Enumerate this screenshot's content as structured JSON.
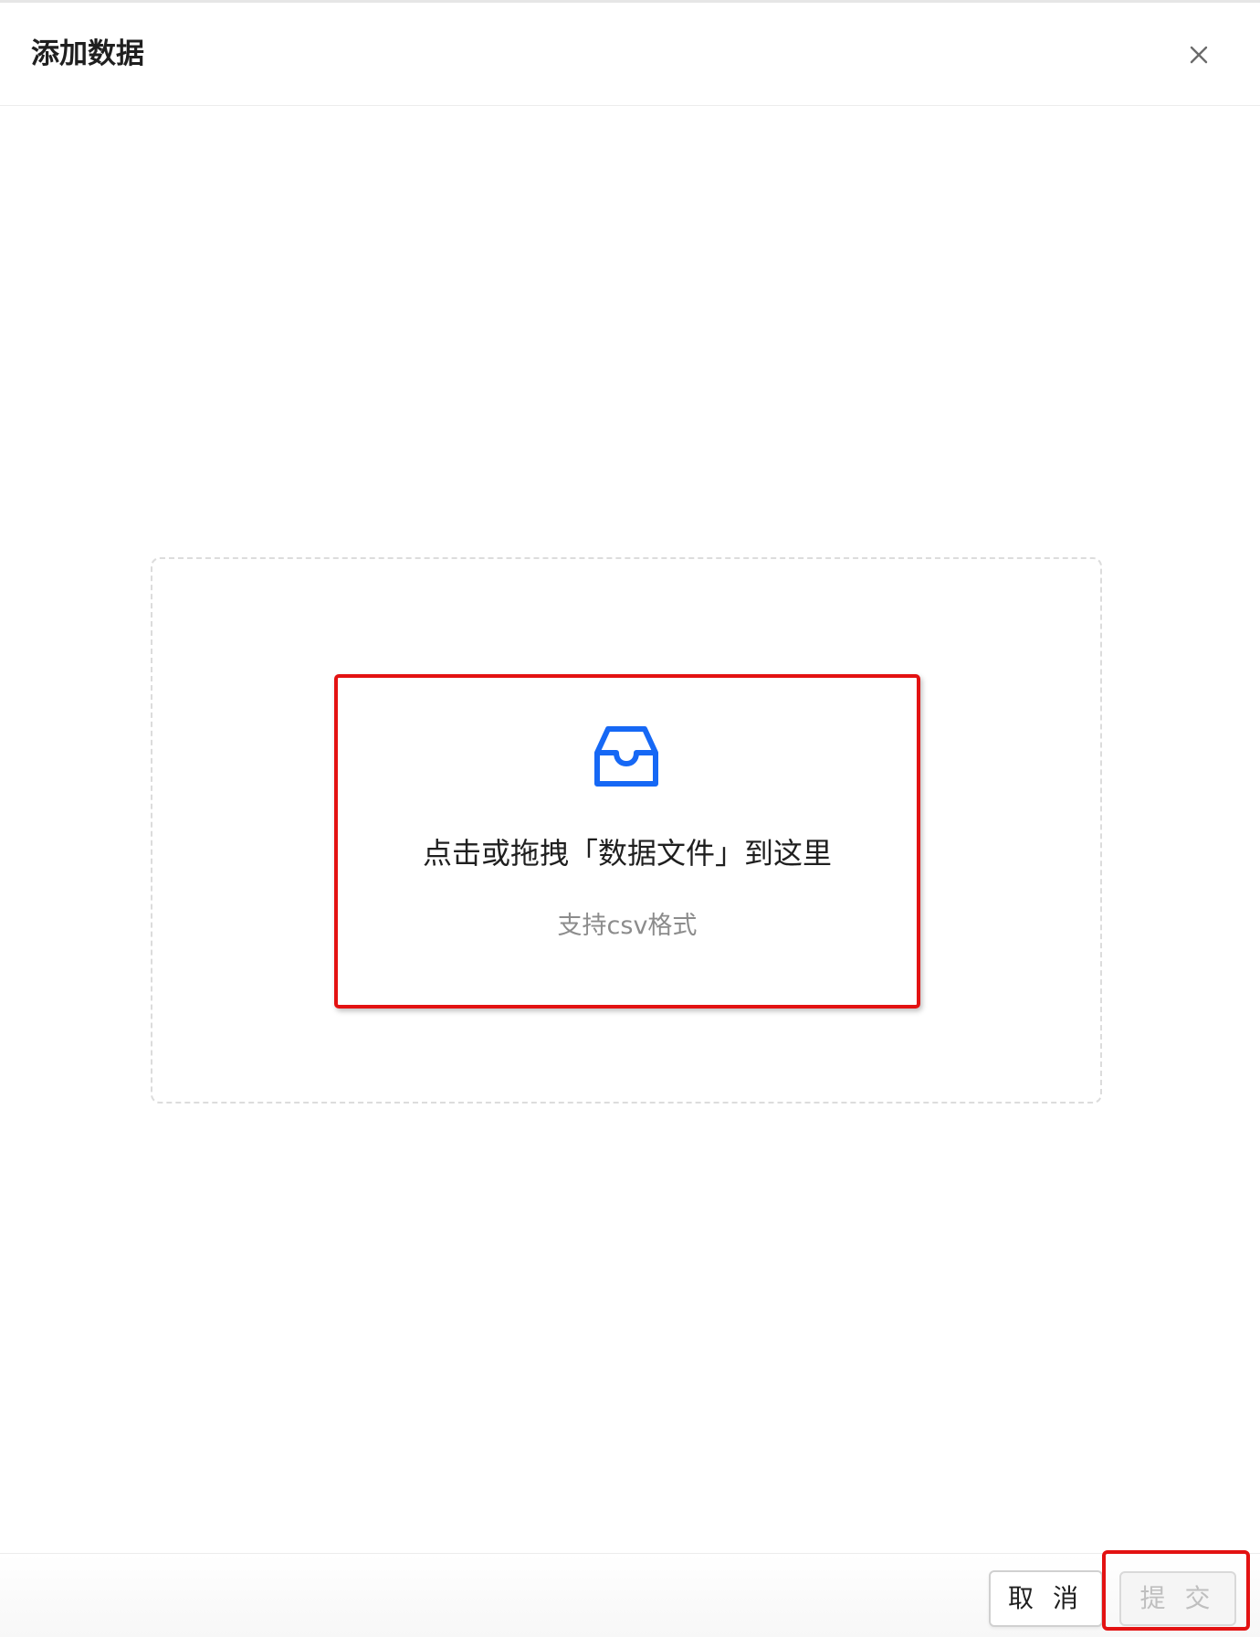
{
  "modal": {
    "title": "添加数据",
    "close_icon": "close-icon"
  },
  "upload": {
    "icon": "inbox-icon",
    "icon_color": "#1668f5",
    "text": "点击或拖拽「数据文件」到这里",
    "hint": "支持csv格式"
  },
  "footer": {
    "cancel_label": "取 消",
    "submit_label": "提 交",
    "submit_disabled": true
  },
  "highlight_color": "#e31212"
}
